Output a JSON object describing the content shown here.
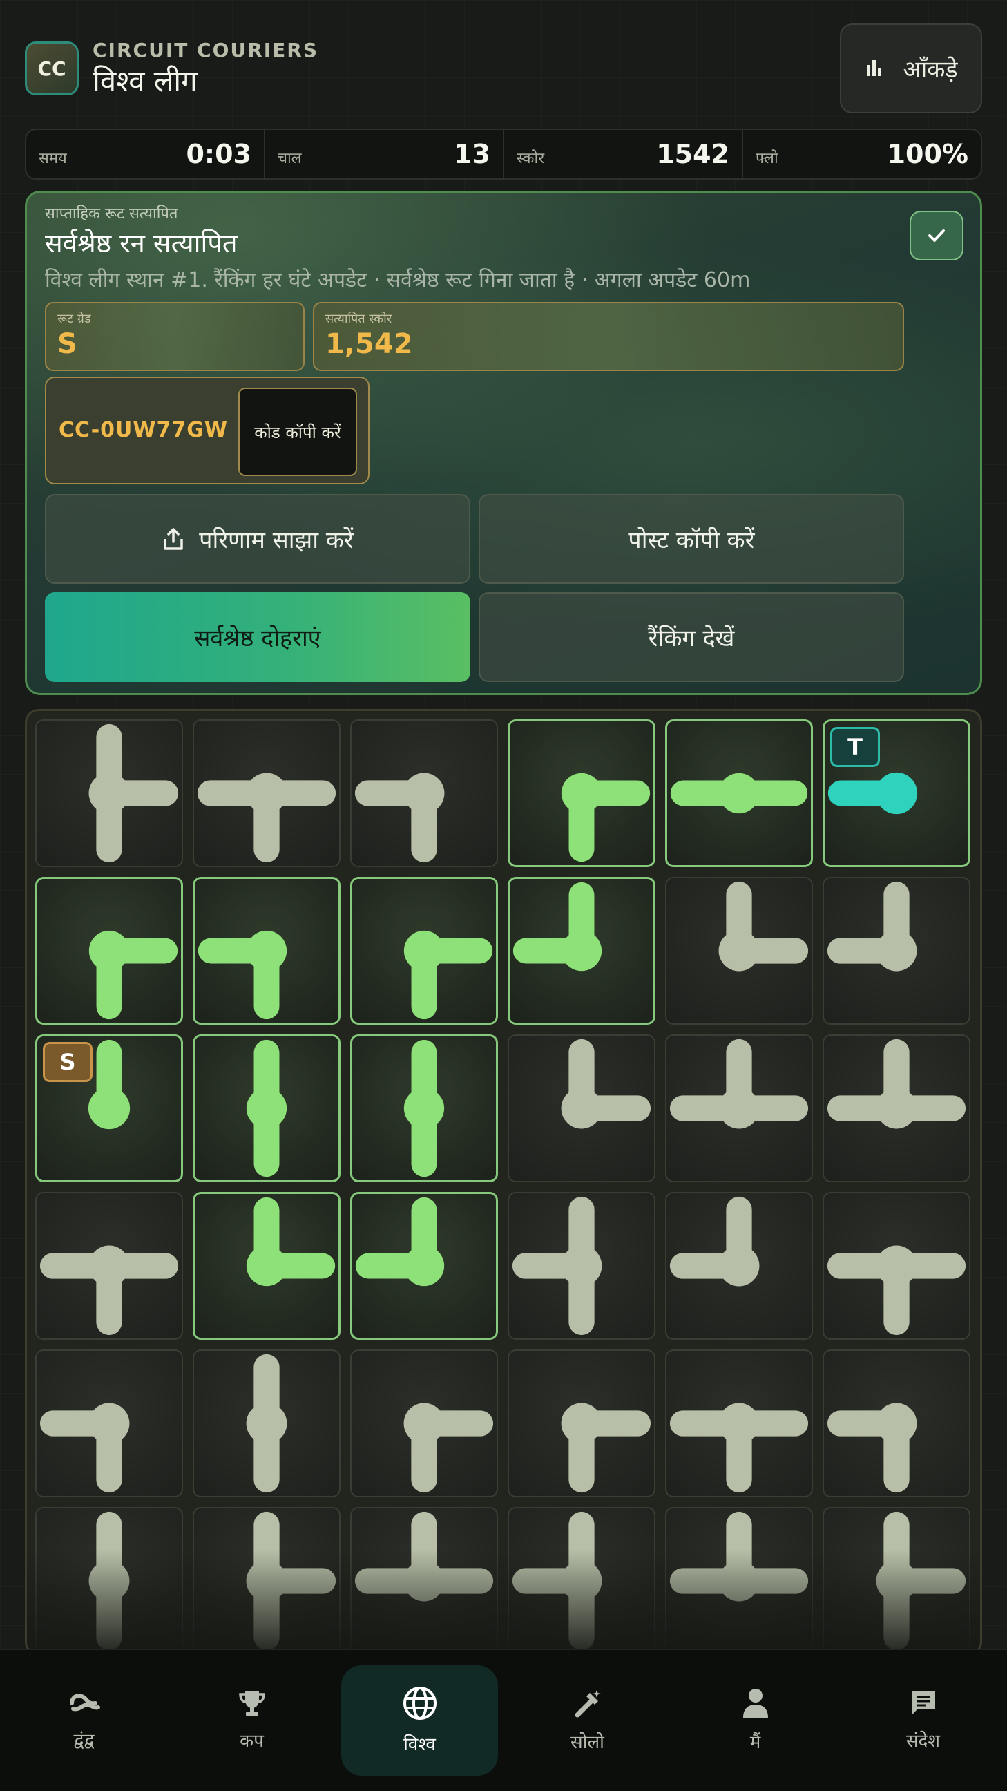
{
  "header": {
    "logo": "CC",
    "brand": "CIRCUIT COURIERS",
    "league": "विश्व लीग",
    "stats_button": "आँकड़े"
  },
  "stats": [
    {
      "label": "समय",
      "value": "0:03"
    },
    {
      "label": "चाल",
      "value": "13"
    },
    {
      "label": "स्कोर",
      "value": "1542"
    },
    {
      "label": "फ्लो",
      "value": "100%"
    }
  ],
  "result": {
    "eyebrow": "साप्ताहिक रूट सत्यापित",
    "title": "सर्वश्रेष्ठ रन सत्यापित",
    "subtitle": "विश्व लीग स्थान #1. रैंकिंग हर घंटे अपडेट · सर्वश्रेष्ठ रूट गिना जाता है · अगला अपडेट 60m",
    "grade_label": "रूट ग्रेड",
    "grade": "S",
    "score_label": "सत्यापित स्कोर",
    "score": "1,542",
    "code": "CC-0UW77GW",
    "copy_code": "कोड कॉपी करें",
    "share": "परिणाम साझा करें",
    "copy_post": "पोस्ट कॉपी करें",
    "replay": "सर्वश्रेष्ठ दोहराएं",
    "rankings": "रैंकिंग देखें"
  },
  "board": {
    "rows": 6,
    "cols": 6,
    "start_label": "S",
    "target_label": "T",
    "colors": {
      "powered": "#8ee078",
      "idle": "#b7bfa8",
      "target": "#2fd3bd"
    },
    "tiles": [
      [
        {
          "arms": "NES",
          "on": false
        },
        {
          "arms": "ESW",
          "on": false
        },
        {
          "arms": "SW",
          "on": false
        },
        {
          "arms": "ES",
          "on": true
        },
        {
          "arms": "EW",
          "on": true
        },
        {
          "arms": "W",
          "on": true,
          "badge": "T"
        }
      ],
      [
        {
          "arms": "ES",
          "on": true
        },
        {
          "arms": "SW",
          "on": true
        },
        {
          "arms": "ES",
          "on": true
        },
        {
          "arms": "NW",
          "on": true
        },
        {
          "arms": "NE",
          "on": false
        },
        {
          "arms": "NW",
          "on": false
        }
      ],
      [
        {
          "arms": "N",
          "on": true,
          "badge": "S"
        },
        {
          "arms": "NS",
          "on": true
        },
        {
          "arms": "NS",
          "on": true
        },
        {
          "arms": "NE",
          "on": false
        },
        {
          "arms": "NEW",
          "on": false
        },
        {
          "arms": "NEW",
          "on": false
        }
      ],
      [
        {
          "arms": "ESW",
          "on": false
        },
        {
          "arms": "NE",
          "on": true
        },
        {
          "arms": "NW",
          "on": true
        },
        {
          "arms": "NSW",
          "on": false
        },
        {
          "arms": "NW",
          "on": false
        },
        {
          "arms": "ESW",
          "on": false
        }
      ],
      [
        {
          "arms": "SW",
          "on": false
        },
        {
          "arms": "NS",
          "on": false
        },
        {
          "arms": "ES",
          "on": false
        },
        {
          "arms": "ES",
          "on": false
        },
        {
          "arms": "ESW",
          "on": false
        },
        {
          "arms": "SW",
          "on": false
        }
      ],
      [
        {
          "arms": "NS",
          "on": false
        },
        {
          "arms": "NES",
          "on": false
        },
        {
          "arms": "NEW",
          "on": false
        },
        {
          "arms": "NSW",
          "on": false
        },
        {
          "arms": "NEW",
          "on": false
        },
        {
          "arms": "NES",
          "on": false
        }
      ]
    ]
  },
  "nav": [
    {
      "label": "द्वंद्व",
      "icon": "duel-icon",
      "active": false
    },
    {
      "label": "कप",
      "icon": "trophy-icon",
      "active": false
    },
    {
      "label": "विश्व",
      "icon": "globe-icon",
      "active": true
    },
    {
      "label": "सोलो",
      "icon": "solo-icon",
      "active": false
    },
    {
      "label": "मैं",
      "icon": "person-icon",
      "active": false
    },
    {
      "label": "संदेश",
      "icon": "message-icon",
      "active": false
    }
  ]
}
